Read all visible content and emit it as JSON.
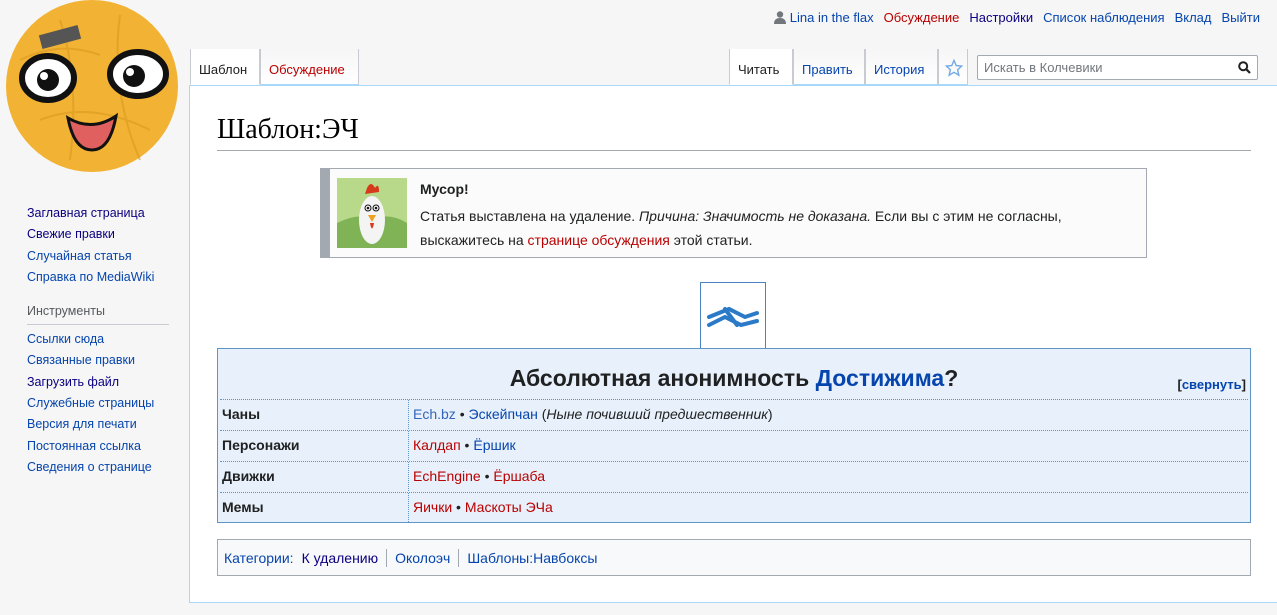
{
  "personal": {
    "user": "Lina in the flax",
    "discussion": "Обсуждение",
    "settings": "Настройки",
    "watchlist": "Список наблюдения",
    "login": "Вклад",
    "logout": "Выйти"
  },
  "tabs": {
    "template": "Шаблон",
    "talk": "Обсуждение",
    "read": "Читать",
    "edit": "Править",
    "history": "История"
  },
  "search": {
    "placeholder": "Искать в Колчевики"
  },
  "sidebar": {
    "nav": [
      {
        "label": "Заглавная страница"
      },
      {
        "label": "Свежие правки"
      },
      {
        "label": "Случайная статья"
      },
      {
        "label": "Справка по MediaWiki"
      }
    ],
    "tools_heading": "Инструменты",
    "tools": [
      {
        "label": "Ссылки сюда"
      },
      {
        "label": "Связанные правки"
      },
      {
        "label": "Загрузить файл"
      },
      {
        "label": "Служебные страницы"
      },
      {
        "label": "Версия для печати"
      },
      {
        "label": "Постоянная ссылка"
      },
      {
        "label": "Сведения о странице"
      }
    ]
  },
  "page": {
    "title": "Шаблон:ЭЧ"
  },
  "notice": {
    "title": "Мусор!",
    "text_1": "Статья выставлена на удаление. ",
    "reason": "Причина: Значимость не доказана.",
    "text_2": " Если вы с этим не согласны, выскажитесь на ",
    "link": "странице обсуждения",
    "text_3": " этой статьи."
  },
  "navbox": {
    "title_plain": "Абсолютная анонимность ",
    "title_link": "Достижима",
    "title_end": "?",
    "collapse": "свернуть",
    "rows": [
      {
        "label": "Чаны",
        "item_1": "Ech.bz",
        "item_2": "Эскейпчан",
        "note": "Ныне почивший предшественник"
      },
      {
        "label": "Персонажи",
        "item_1": "Калдап",
        "item_2": "Ёршик"
      },
      {
        "label": "Движки",
        "item_1": "EchEngine",
        "item_2": "Ёршаба"
      },
      {
        "label": "Мемы",
        "item_1": "Яички",
        "item_2": "Маскоты ЭЧа"
      }
    ]
  },
  "categories": {
    "label": "Категории:",
    "items": [
      "К удалению",
      "Околоэч",
      "Шаблоны:Навбоксы"
    ]
  },
  "colors": {
    "link": "#0645ad",
    "new_link": "#ba0000",
    "navbox_bg": "#e8f1fb",
    "navbox_border": "#5d95c9"
  }
}
